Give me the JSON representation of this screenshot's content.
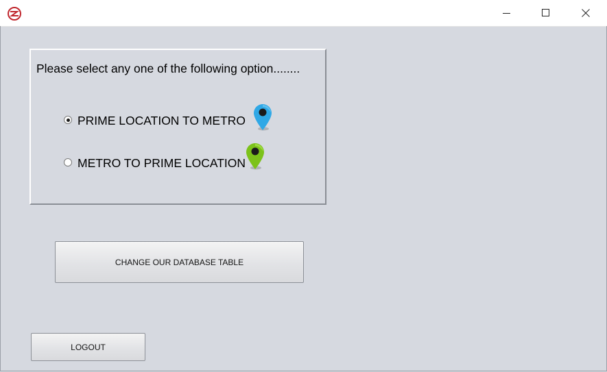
{
  "titlebar": {
    "app_icon": "metro-logo-icon",
    "controls": [
      "minimize-icon",
      "maximize-icon",
      "close-icon"
    ]
  },
  "panel": {
    "prompt": "Please select any one of the following option........",
    "options": [
      {
        "label": "PRIME LOCATION TO METRO",
        "selected": true,
        "pin_icon": "location-pin-icon",
        "pin_color": "#2fa8e6"
      },
      {
        "label": "METRO TO PRIME LOCATION",
        "selected": false,
        "pin_icon": "location-pin-icon",
        "pin_color": "#7cc21a"
      }
    ]
  },
  "buttons": {
    "change_db": "CHANGE OUR DATABASE TABLE",
    "logout": "LOGOUT"
  },
  "colors": {
    "background": "#d6d9e0",
    "titlebar": "#ffffff",
    "logo": "#c0262d"
  }
}
